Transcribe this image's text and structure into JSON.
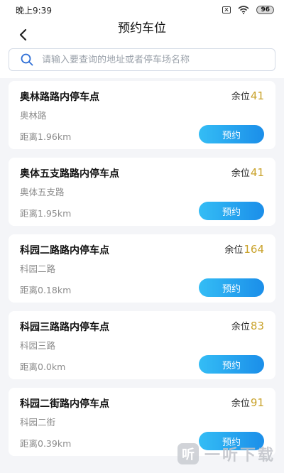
{
  "status_bar": {
    "time": "晚上9:39",
    "battery": "96"
  },
  "header": {
    "title": "预约车位"
  },
  "search": {
    "placeholder": "请输入要查询的地址或者停车场名称",
    "value": ""
  },
  "lots": [
    {
      "name": "奥林路路内停车点",
      "road": "奥林路",
      "distance": "距离1.96km",
      "avail_label": "余位",
      "avail_count": "41",
      "button": "预约"
    },
    {
      "name": "奥体五支路路内停车点",
      "road": "奥体五支路",
      "distance": "距离1.95km",
      "avail_label": "余位",
      "avail_count": "41",
      "button": "预约"
    },
    {
      "name": "科园二路路内停车点",
      "road": "科园二路",
      "distance": "距离0.18km",
      "avail_label": "余位",
      "avail_count": "164",
      "button": "预约"
    },
    {
      "name": "科园三路路内停车点",
      "road": "科园三路",
      "distance": "距离0.0km",
      "avail_label": "余位",
      "avail_count": "83",
      "button": "预约"
    },
    {
      "name": "科园二街路内停车点",
      "road": "科园二街",
      "distance": "距离0.39km",
      "avail_label": "余位",
      "avail_count": "91",
      "button": "预约"
    }
  ],
  "watermark": {
    "logo": "听",
    "text": "一听下载"
  },
  "colors": {
    "accent_button": "#1b8ee9",
    "count_gold": "#c9a22a",
    "background": "#f4f5f8"
  },
  "icons": {
    "back": "chevron-left-icon",
    "search": "search-icon",
    "wifi": "wifi-icon",
    "sim": "sim-off-icon"
  }
}
